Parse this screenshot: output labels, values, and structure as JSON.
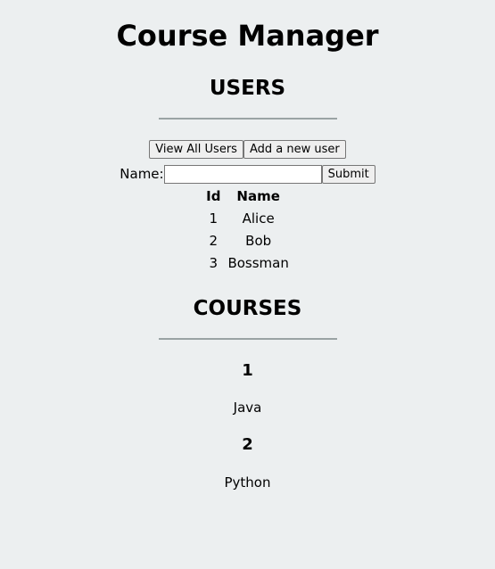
{
  "app": {
    "title": "Course Manager"
  },
  "users": {
    "heading": "USERS",
    "buttons": {
      "view_all": "View All Users",
      "add_new": "Add a new user"
    },
    "form": {
      "name_label": "Name:",
      "name_value": "",
      "submit_label": "Submit"
    },
    "table": {
      "columns": [
        "Id",
        "Name"
      ],
      "rows": [
        [
          "1",
          "Alice"
        ],
        [
          "2",
          "Bob"
        ],
        [
          "3",
          "Bossman"
        ]
      ]
    }
  },
  "courses": {
    "heading": "COURSES",
    "items": [
      {
        "id": "1",
        "name": "Java"
      },
      {
        "id": "2",
        "name": "Python"
      }
    ]
  },
  "colors": {
    "background": "#eceff0",
    "rule": "#9aa3a4",
    "button_bg": "#efefef",
    "button_border": "#767676"
  }
}
